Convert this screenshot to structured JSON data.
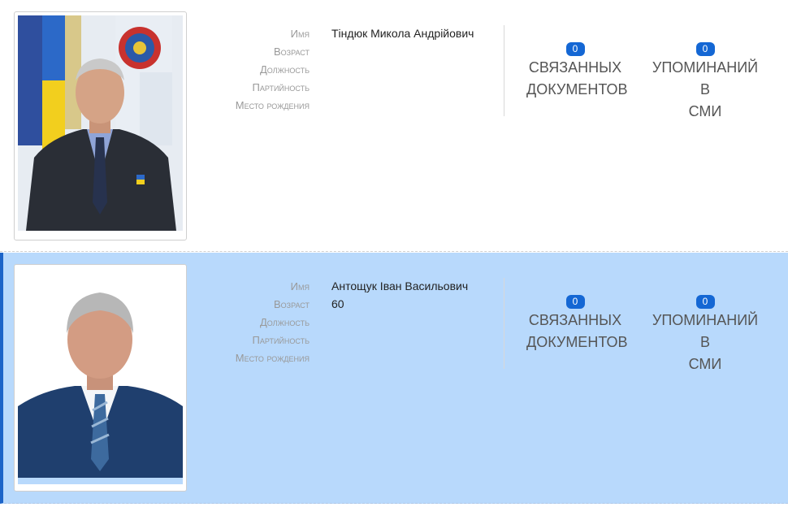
{
  "people": [
    {
      "fields": [
        {
          "label": "Имя",
          "value": "Тіндюк Микола Андрійович"
        },
        {
          "label": "Возраст",
          "value": ""
        },
        {
          "label": "Должность",
          "value": ""
        },
        {
          "label": "Партийность",
          "value": ""
        },
        {
          "label": "Место рождения",
          "value": ""
        }
      ],
      "stats": {
        "documents": {
          "count": "0",
          "label_line1": "СВЯЗАННЫХ",
          "label_line2": "ДОКУМЕНТОВ"
        },
        "media": {
          "count": "0",
          "label_line1": "УПОМИНАНИЙ В",
          "label_line2": "СМИ"
        }
      },
      "highlighted": false
    },
    {
      "fields": [
        {
          "label": "Имя",
          "value": "Антощук Іван Васильович"
        },
        {
          "label": "Возраст",
          "value": "60"
        },
        {
          "label": "Должность",
          "value": ""
        },
        {
          "label": "Партийность",
          "value": ""
        },
        {
          "label": "Место рождения",
          "value": ""
        }
      ],
      "stats": {
        "documents": {
          "count": "0",
          "label_line1": "СВЯЗАННЫХ",
          "label_line2": "ДОКУМЕНТОВ"
        },
        "media": {
          "count": "0",
          "label_line1": "УПОМИНАНИЙ В",
          "label_line2": "СМИ"
        }
      },
      "highlighted": true
    }
  ],
  "colors": {
    "highlight_bg": "#b8d9fc",
    "highlight_border": "#1c64c8",
    "badge": "#1467d4"
  }
}
